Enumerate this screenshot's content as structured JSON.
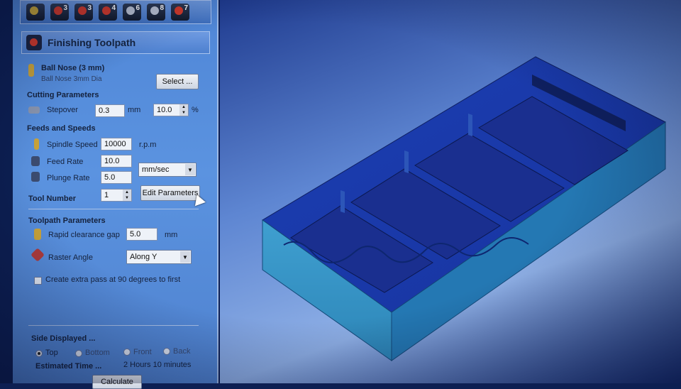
{
  "toolbar": {
    "buttons": [
      {
        "num": "",
        "icon": "ruler-icon",
        "color": "#c8a838"
      },
      {
        "num": "3",
        "icon": "red-drill-icon",
        "color": "#d23a2a"
      },
      {
        "num": "3",
        "icon": "red-drill-icon",
        "color": "#d23a2a"
      },
      {
        "num": "4",
        "icon": "red-drill-icon",
        "color": "#d23a2a"
      },
      {
        "num": "6",
        "icon": "drill-icon",
        "color": "#b8c0d0"
      },
      {
        "num": "8",
        "icon": "drill-icon",
        "color": "#b8c0d0"
      },
      {
        "num": "7",
        "icon": "drill-icon",
        "color": "#d23a2a"
      }
    ]
  },
  "header": {
    "title": "Finishing Toolpath"
  },
  "tool": {
    "name": "Ball Nose (3 mm)",
    "description": "Ball Nose 3mm Dia",
    "select_label": "Select ..."
  },
  "cutting": {
    "section": "Cutting Parameters",
    "stepover_label": "Stepover",
    "stepover_value": "0.3",
    "stepover_unit": "mm",
    "percent_value": "10.0",
    "percent_unit": "%"
  },
  "feeds": {
    "section": "Feeds and Speeds",
    "spindle_label": "Spindle Speed",
    "spindle_value": "10000",
    "spindle_unit": "r.p.m",
    "feed_label": "Feed Rate",
    "feed_value": "10.0",
    "plunge_label": "Plunge Rate",
    "plunge_value": "5.0",
    "rate_unit": "mm/sec",
    "tool_number_label": "Tool Number",
    "tool_number_value": "1",
    "edit_params_label": "Edit Parameters"
  },
  "toolpath": {
    "section": "Toolpath Parameters",
    "clearance_label": "Rapid clearance gap",
    "clearance_value": "5.0",
    "clearance_unit": "mm",
    "raster_label": "Raster Angle",
    "raster_value": "Along Y",
    "extra_pass_label": "Create extra pass at 90 degrees to first"
  },
  "side": {
    "section": "Side Displayed ...",
    "options": [
      "Top",
      "Bottom",
      "Front",
      "Back"
    ],
    "selected": "Top",
    "estimated_label": "Estimated Time ...",
    "estimated_value": "2 Hours 10 minutes",
    "calculate_label": "Calculate"
  }
}
